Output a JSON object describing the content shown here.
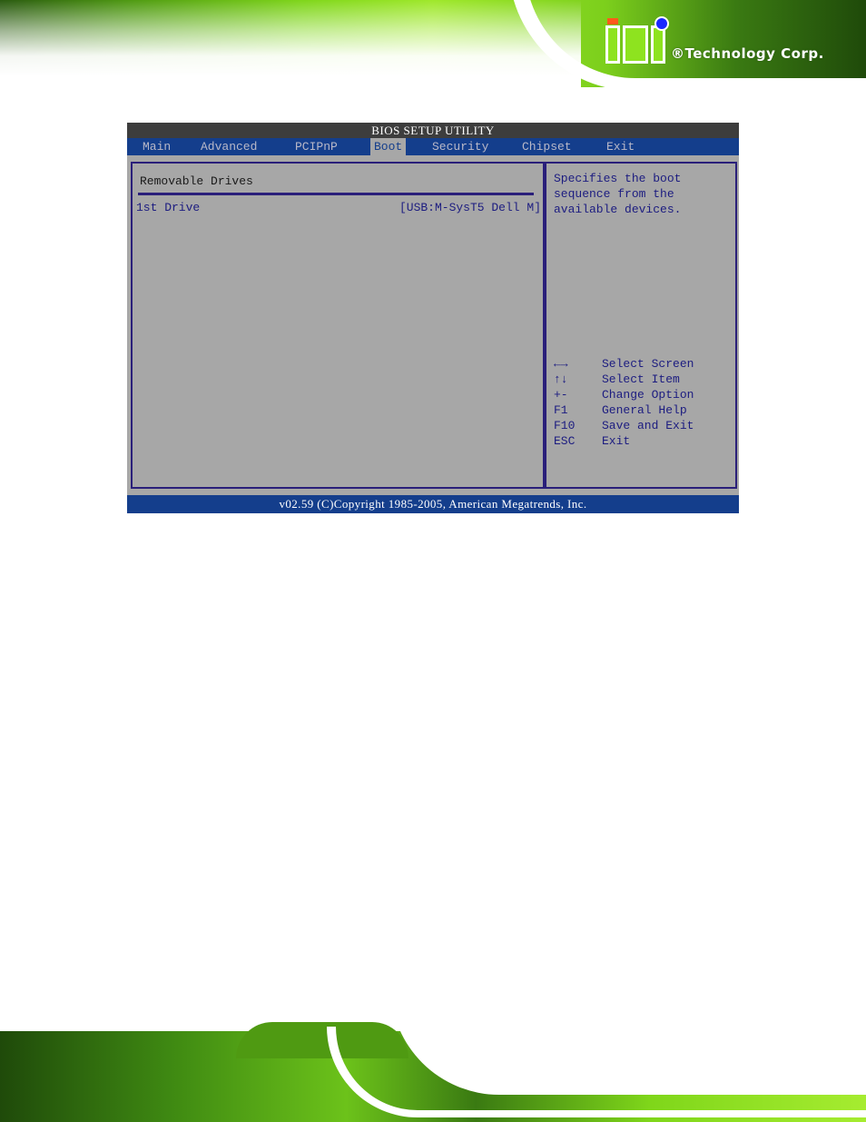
{
  "brand": {
    "logo_text": "iEi",
    "company": "®Technology Corp."
  },
  "bios": {
    "title": "BIOS SETUP UTILITY",
    "tabs": [
      {
        "label": "Main",
        "active": false
      },
      {
        "label": "Advanced",
        "active": false
      },
      {
        "label": "PCIPnP",
        "active": false
      },
      {
        "label": "Boot",
        "active": true
      },
      {
        "label": "Security",
        "active": false
      },
      {
        "label": "Chipset",
        "active": false
      },
      {
        "label": "Exit",
        "active": false
      }
    ],
    "section_title": "Removable Drives",
    "items": [
      {
        "label": "1st Drive",
        "value": "[USB:M-SysT5 Dell M]"
      }
    ],
    "help_text": "Specifies the boot\nsequence from the\navailable devices.",
    "keys": [
      {
        "key": "←→",
        "action": "Select Screen",
        "icon": "left-right-arrows-icon"
      },
      {
        "key": "↑↓",
        "action": "Select Item",
        "icon": "up-down-arrows-icon"
      },
      {
        "key": "+-",
        "action": "Change Option"
      },
      {
        "key": "F1",
        "action": "General Help"
      },
      {
        "key": "F10",
        "action": "Save and Exit"
      },
      {
        "key": "ESC",
        "action": "Exit"
      }
    ],
    "footer": "v02.59 (C)Copyright 1985-2005, American Megatrends, Inc."
  },
  "colors": {
    "menubar": "#143e8c",
    "panel_bg": "#a7a7a7",
    "text_blue": "#1c1c80",
    "titlebar": "#3d3d3d",
    "border": "#2a1f7a"
  }
}
